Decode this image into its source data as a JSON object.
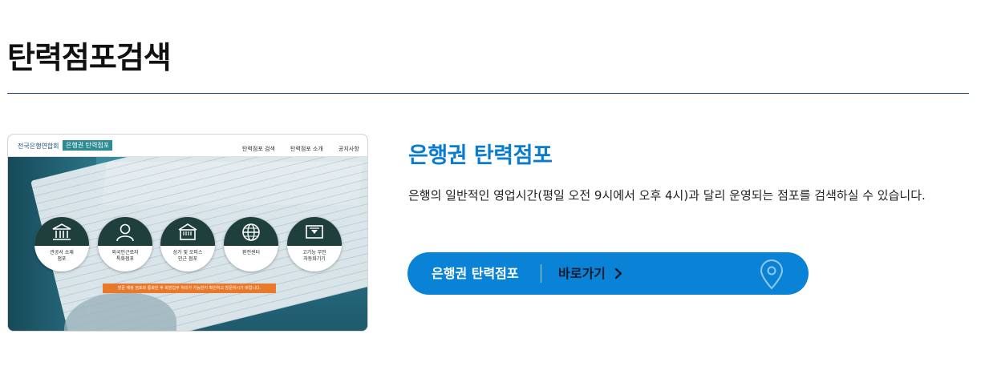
{
  "page": {
    "title": "탄력점포검색"
  },
  "thumbnail": {
    "brand": "전국은행연합회",
    "brand_tag": "은행권 탄력점포",
    "nav": [
      "탄력점포 검색",
      "탄력점포 소개",
      "공지사항"
    ],
    "circles": [
      {
        "icon": "government-building-icon",
        "label_1": "관공서 소재",
        "label_2": "점포"
      },
      {
        "icon": "person-icon",
        "label_1": "외국인근로자",
        "label_2": "특화점포"
      },
      {
        "icon": "shop-icon",
        "label_1": "상가 및 오피스",
        "label_2": "인근 점포"
      },
      {
        "icon": "globe-icon",
        "label_1": "환전센터",
        "label_2": ""
      },
      {
        "icon": "atm-icon",
        "label_1": "고기능 무인",
        "label_2": "자동화기기"
      }
    ],
    "notice": "방문 예정 점포와 통화한 후 희망업무 처리가 가능한지 확인하고 방문하시기 바랍니다."
  },
  "section": {
    "heading": "은행권 탄력점포",
    "description": "은행의 일반적인 영업시간(평일 오전 9시에서 오후 4시)과 달리 운영되는 점포를 검색하실 수 있습니다."
  },
  "cta": {
    "label": "은행권 탄력점포",
    "link_text": "바로가기",
    "icon": "map-pin-icon"
  },
  "colors": {
    "accent": "#0a83d6",
    "heading_blue": "#0a7cd0",
    "rule": "#1d3f6e",
    "notice_orange": "#e8782a"
  }
}
